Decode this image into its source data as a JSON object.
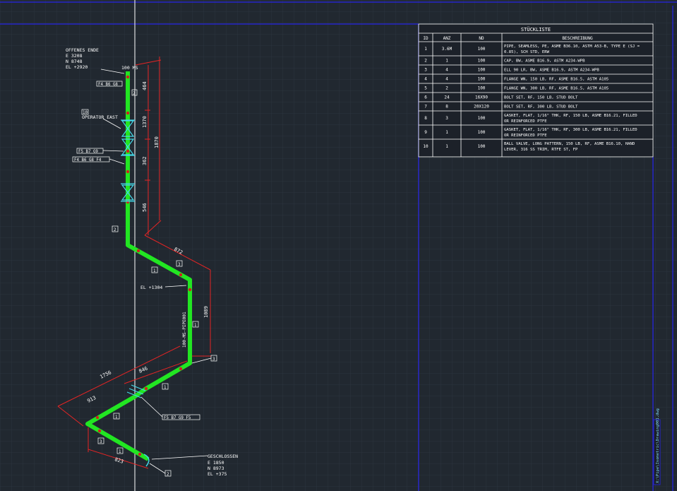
{
  "annotations": {
    "start_title": "OFFENES ENDE",
    "start_e": "E 3208",
    "start_n": "N 8748",
    "start_el": "EL +2920",
    "end_title": "GESCHLOSSEN",
    "end_e": "E 1850",
    "end_n": "N 8973",
    "end_el": "EL +375",
    "nd_label": "100 MS",
    "operator_tag": "10",
    "operator": "OPERATOR EAST",
    "elev_mid": "EL +1304",
    "pipe_spec": "100-MS-PIPE001",
    "callout_1": "F4 B6 G8",
    "callout_2": "F5 B7 G9",
    "callout_3": "F4 B6 G8 F4",
    "callout_4": "F5 B7 G9 F5",
    "item_2": "2",
    "item_3": "3",
    "item_1": "1"
  },
  "dimensions": {
    "d1": "464",
    "d2": "1370",
    "d3": "1870",
    "d4": "362",
    "d5": "546",
    "d6": "872",
    "d7": "1089",
    "d8": "1756",
    "d9": "846",
    "d10": "913",
    "d11": "823"
  },
  "bom": {
    "title": "STÜCKLISTE",
    "headers": [
      "ID",
      "ANZ",
      "ND",
      "BESCHREIBUNG"
    ],
    "rows": [
      {
        "id": "1",
        "qty": "3.6M",
        "nd": "100",
        "desc1": "PIPE, SEAMLESS, PE, ASME B36.10, ASTM A53-B, TYPE E (SJ =",
        "desc2": "0.85), SCH STD, ERW"
      },
      {
        "id": "2",
        "qty": "1",
        "nd": "100",
        "desc1": "CAP, BW, ASME B16.9, ASTM A234-WPB",
        "desc2": ""
      },
      {
        "id": "3",
        "qty": "4",
        "nd": "100",
        "desc1": "ELL 90 LR, BW, ASME B16.9, ASTM A234-WPB",
        "desc2": ""
      },
      {
        "id": "4",
        "qty": "4",
        "nd": "100",
        "desc1": "FLANGE WN, 150 LB, RF, ASME B16.5, ASTM A105",
        "desc2": ""
      },
      {
        "id": "5",
        "qty": "2",
        "nd": "100",
        "desc1": "FLANGE WN, 300 LB, RF, ASME B16.5, ASTM A105",
        "desc2": ""
      },
      {
        "id": "6",
        "qty": "24",
        "nd": "16X90",
        "desc1": "BOLT SET, RF, 150 LB, STUD BOLT",
        "desc2": ""
      },
      {
        "id": "7",
        "qty": "8",
        "nd": "20X120",
        "desc1": "BOLT SET, RF, 300 LB, STUD BOLT",
        "desc2": ""
      },
      {
        "id": "8",
        "qty": "3",
        "nd": "100",
        "desc1": "GASKET, FLAT, 1/16\" THK, RF, 150 LB, ASME B16.21, FILLED",
        "desc2": "OR REINFORCED PTFE"
      },
      {
        "id": "9",
        "qty": "1",
        "nd": "100",
        "desc1": "GASKET, FLAT, 1/16\" THK, RF, 300 LB, ASME B16.21, FILLED",
        "desc2": "OR REINFORCED PTFE"
      },
      {
        "id": "10",
        "qty": "1",
        "nd": "100",
        "desc1": "BALL VALVE, LONG PATTERN, 150 LB, RF, ASME B16.10, HAND",
        "desc2": "LEVER, 316 SS TRIM, RTFE ST, FP"
      }
    ]
  },
  "sheet_label": "X:\\Pipe\\Isometric\\Drawing001.dwg",
  "colors": {
    "background": "#212830",
    "grid": "#2d3540",
    "pipe": "#22e622",
    "weld": "#d02020",
    "dimension": "#e52424",
    "text": "#ffffff",
    "frame": "#2626c8",
    "valve": "#44d8e8"
  }
}
